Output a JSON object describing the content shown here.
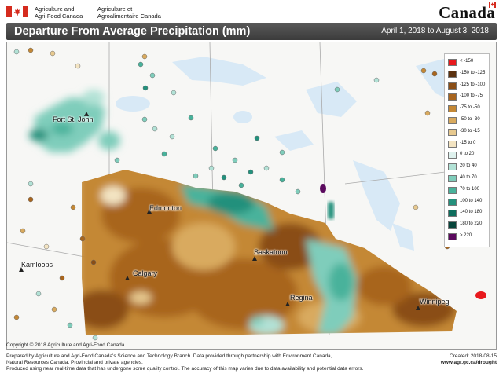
{
  "header": {
    "dept_en_line1": "Agriculture and",
    "dept_en_line2": "Agri-Food Canada",
    "dept_fr_line1": "Agriculture et",
    "dept_fr_line2": "Agroalimentaire Canada",
    "wordmark": "Canada"
  },
  "title": "Departure From Average Precipitation (mm)",
  "date_range": "April 1, 2018 to August 3, 2018",
  "cities": [
    {
      "name": "Fort St. John"
    },
    {
      "name": "Edmonton"
    },
    {
      "name": "Kamloops"
    },
    {
      "name": "Calgary"
    },
    {
      "name": "Saskatoon"
    },
    {
      "name": "Regina"
    },
    {
      "name": "Winnipeg"
    }
  ],
  "legend": [
    {
      "label": "< -150",
      "color": "#e8191d"
    },
    {
      "label": "-150 to -125",
      "color": "#5c3210"
    },
    {
      "label": "-125 to -100",
      "color": "#8a4e16"
    },
    {
      "label": "-100 to -75",
      "color": "#a8651e"
    },
    {
      "label": "-75 to -50",
      "color": "#c48835"
    },
    {
      "label": "-50 to -30",
      "color": "#d9aa5e"
    },
    {
      "label": "-30 to -15",
      "color": "#e7c98f"
    },
    {
      "label": "-15 to 0",
      "color": "#f3e4c2"
    },
    {
      "label": "0 to 20",
      "color": "#dff2ee"
    },
    {
      "label": "20 to 40",
      "color": "#b2e2d6"
    },
    {
      "label": "40 to 70",
      "color": "#7fcdbb"
    },
    {
      "label": "70 to 100",
      "color": "#48b29b"
    },
    {
      "label": "100 to 140",
      "color": "#24907c"
    },
    {
      "label": "140 to 180",
      "color": "#0f6e5d"
    },
    {
      "label": "180 to 220",
      "color": "#07453b"
    },
    {
      "label": "> 220",
      "color": "#5b0a5e"
    }
  ],
  "footer": {
    "copyright": "Copyright © 2018 Agriculture and Agri-Food Canada",
    "line1": "Prepared by Agriculture and Agri-Food Canada's Science and Technology Branch. Data provided through partnership with Environment Canada,",
    "line2": "Natural Resources Canada, Provincial and private agencies.",
    "line3": "Produced using near real-time data that has undergone some quality control. The accuracy of this map varies due to data availability and potential data errors.",
    "created": "Created: 2018-08-15",
    "url": "www.agr.gc.ca/drought"
  }
}
